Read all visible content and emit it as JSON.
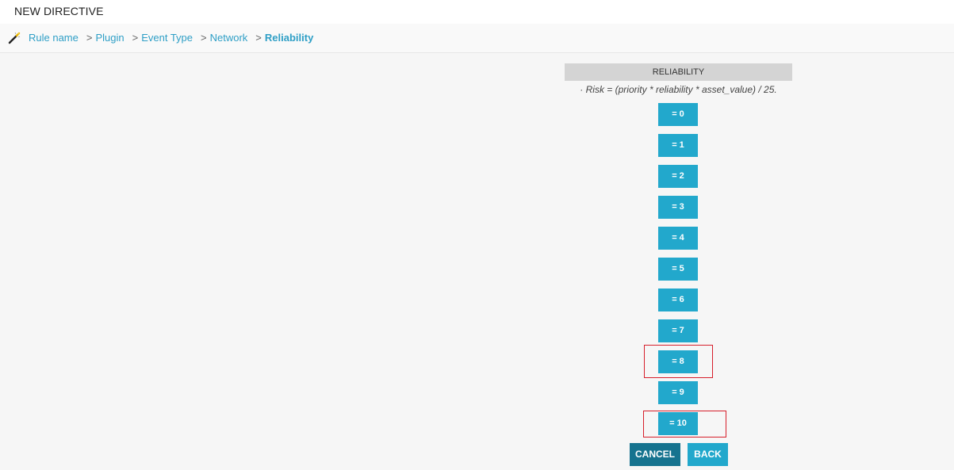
{
  "window": {
    "title": "NEW DIRECTIVE"
  },
  "breadcrumb": {
    "icon": "wand-icon",
    "items": [
      {
        "label": "Rule name",
        "active": false
      },
      {
        "label": "Plugin",
        "active": false
      },
      {
        "label": "Event Type",
        "active": false
      },
      {
        "label": "Network",
        "active": false
      },
      {
        "label": "Reliability",
        "active": true
      }
    ],
    "separator": ">"
  },
  "panel": {
    "header": "RELIABILITY",
    "formula": "· Risk = (priority * reliability * asset_value) / 25."
  },
  "options": [
    {
      "label": "= 0",
      "highlighted": false
    },
    {
      "label": "= 1",
      "highlighted": false
    },
    {
      "label": "= 2",
      "highlighted": false
    },
    {
      "label": "= 3",
      "highlighted": false
    },
    {
      "label": "= 4",
      "highlighted": false
    },
    {
      "label": "= 5",
      "highlighted": false
    },
    {
      "label": "= 6",
      "highlighted": false
    },
    {
      "label": "= 7",
      "highlighted": false
    },
    {
      "label": "= 8",
      "highlighted": true
    },
    {
      "label": "= 9",
      "highlighted": false
    },
    {
      "label": "= 10",
      "highlighted": true
    }
  ],
  "actions": {
    "cancel_label": "CANCEL",
    "back_label": "BACK"
  },
  "colors": {
    "accent": "#22a8cc",
    "accent_dark": "#16738f",
    "highlight_border": "#d61f2b",
    "link": "#2f9fc6"
  }
}
